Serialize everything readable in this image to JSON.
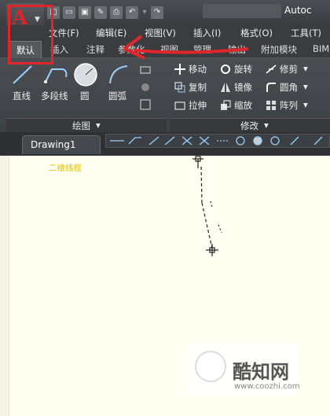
{
  "app": {
    "window_title": "Autoc",
    "logo_letter": "A"
  },
  "quick_access": [
    "new",
    "open",
    "save",
    "save-as",
    "print",
    "undo",
    "redo"
  ],
  "menu": [
    {
      "label": "文件(F)"
    },
    {
      "label": "编辑(E)"
    },
    {
      "label": "视图(V)"
    },
    {
      "label": "插入(I)"
    },
    {
      "label": "格式(O)"
    },
    {
      "label": "工具(T)"
    }
  ],
  "tabs": [
    {
      "label": "默认",
      "active": true
    },
    {
      "label": "插入"
    },
    {
      "label": "注释"
    },
    {
      "label": "参数化"
    },
    {
      "label": "视图"
    },
    {
      "label": "管理"
    },
    {
      "label": "输出"
    },
    {
      "label": "附加模块"
    },
    {
      "label": "BIM"
    }
  ],
  "draw_panel": {
    "title": "绘图",
    "tools": [
      {
        "label": "直线",
        "icon": "line-icon"
      },
      {
        "label": "多段线",
        "icon": "polyline-icon"
      },
      {
        "label": "圆",
        "icon": "circle-icon"
      },
      {
        "label": "圆弧",
        "icon": "arc-icon"
      }
    ]
  },
  "modify_panel": {
    "title": "修改",
    "tools": [
      {
        "label": "移动",
        "icon": "move-icon"
      },
      {
        "label": "旋转",
        "icon": "rotate-icon"
      },
      {
        "label": "修剪",
        "icon": "trim-icon"
      },
      {
        "label": "复制",
        "icon": "copy-icon"
      },
      {
        "label": "镜像",
        "icon": "mirror-icon"
      },
      {
        "label": "圆角",
        "icon": "fillet-icon"
      },
      {
        "label": "拉伸",
        "icon": "stretch-icon"
      },
      {
        "label": "缩放",
        "icon": "scale-icon"
      },
      {
        "label": "阵列",
        "icon": "array-icon"
      }
    ]
  },
  "document": {
    "tab_label": "Drawing1",
    "viewport_label": "二维线框"
  },
  "watermark": {
    "text": "酷知网",
    "url": "www.coozhi.com"
  },
  "colors": {
    "annotation_red": "#e0262b",
    "canvas_bg": "#fffef0",
    "logo_red": "#d8262c"
  }
}
